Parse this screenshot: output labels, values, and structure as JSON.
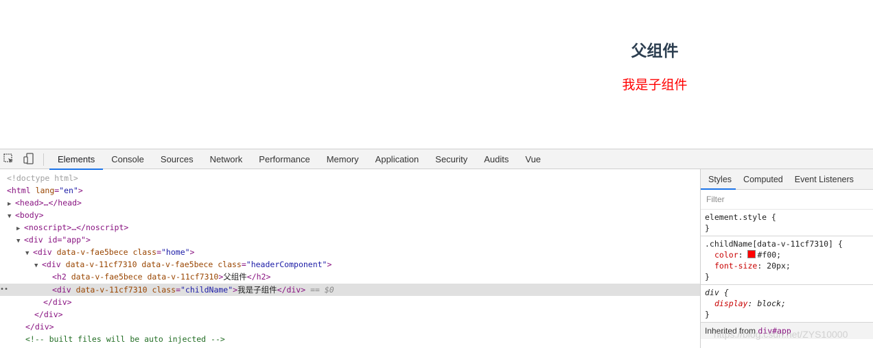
{
  "page": {
    "parent_title": "父组件",
    "child_text": "我是子组件"
  },
  "devtools": {
    "tabs": [
      "Elements",
      "Console",
      "Sources",
      "Network",
      "Performance",
      "Memory",
      "Application",
      "Security",
      "Audits",
      "Vue"
    ],
    "active_tab": "Elements",
    "dom": {
      "doctype": "<!doctype html>",
      "html_open": "<html",
      "html_lang_attr": "lang",
      "html_lang_val": "\"en\"",
      "head": "<head>…</head>",
      "body_open": "<body>",
      "noscript": "<noscript>…</noscript>",
      "div_app": "<div id=\"app\">",
      "div_home_attrs": "data-v-fae5bece",
      "div_home_class": "\"home\"",
      "div_header_attrs": "data-v-11cf7310 data-v-fae5bece",
      "div_header_class": "\"headerComponent\"",
      "h2_attrs": "data-v-fae5bece data-v-11cf7310",
      "h2_text": "父组件",
      "child_attrs": "data-v-11cf7310",
      "child_class": "\"childName\"",
      "child_text": "我是子组件",
      "selected_marker": "== $0",
      "close_div": "</div>",
      "comment": "<!-- built files will be auto injected -->"
    },
    "styles": {
      "sub_tabs": [
        "Styles",
        "Computed",
        "Event Listeners"
      ],
      "active_sub_tab": "Styles",
      "filter_placeholder": "Filter",
      "element_style": "element.style {",
      "rule_brace_close": "}",
      "child_selector": ".childName[data-v-11cf7310] {",
      "color_prop": "color",
      "color_value": "#f00;",
      "font_size_prop": "font-size",
      "font_size_value": "20px;",
      "div_selector": "div {",
      "display_prop": "display",
      "display_value": "block;",
      "inherited_label": "Inherited from",
      "inherited_from": "div#app"
    },
    "watermark": "https://blog.csdn.net/ZYS10000"
  },
  "colors": {
    "accent": "#1a73e8",
    "child_red": "#ff0000",
    "heading": "#2c3e50"
  }
}
